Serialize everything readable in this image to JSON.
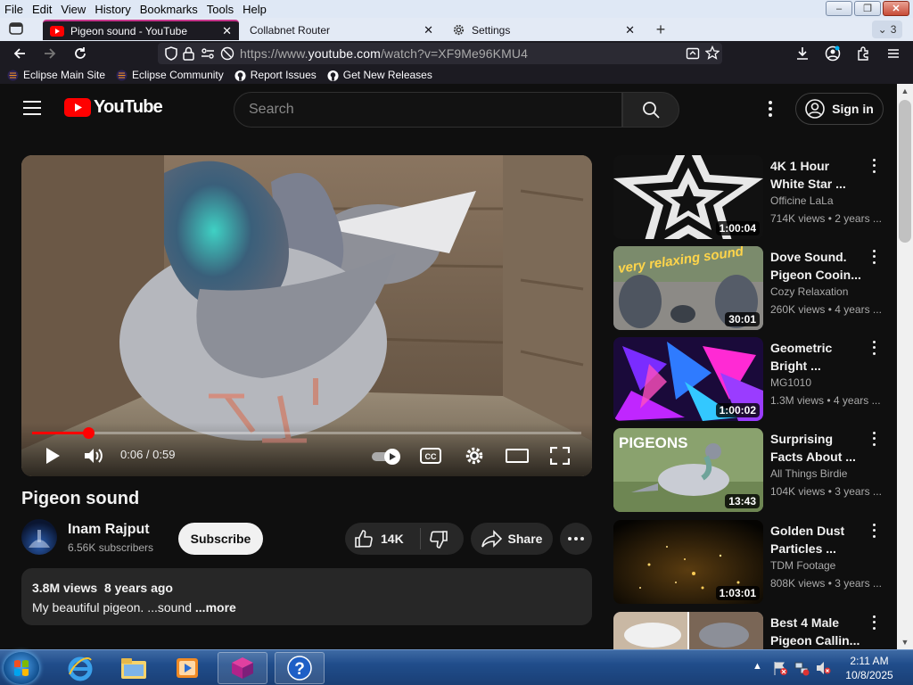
{
  "menubar": {
    "items": [
      "File",
      "Edit",
      "View",
      "History",
      "Bookmarks",
      "Tools",
      "Help"
    ]
  },
  "window_controls": {
    "minimize": "–",
    "maximize": "❐",
    "close": "✕"
  },
  "tabs": [
    {
      "label": "Pigeon sound - YouTube",
      "active": true
    },
    {
      "label": "Collabnet Router",
      "active": false
    },
    {
      "label": "Settings",
      "active": false
    }
  ],
  "tabbar": {
    "new_tab": "+",
    "tab_count": "3"
  },
  "navbar": {
    "url_prefix": "https://www.",
    "url_main": "youtube.com",
    "url_rest": "/watch?v=XF9Me96KMU4"
  },
  "bookmarks": [
    "Eclipse Main Site",
    "Eclipse Community",
    "Report Issues",
    "Get New Releases"
  ],
  "youtube": {
    "logo_text": "YouTube",
    "search_placeholder": "Search",
    "sign_in": "Sign in",
    "player": {
      "time": "0:06 / 0:59",
      "progress_fraction": 0.102
    },
    "video_title": "Pigeon sound",
    "channel": {
      "name": "Inam Rajput",
      "subscribers": "6.56K subscribers"
    },
    "subscribe": "Subscribe",
    "likes": "14K",
    "share": "Share",
    "description": {
      "views": "3.8M views",
      "age": "8 years ago",
      "text": "My beautiful  pigeon. ...sound",
      "more": "...more"
    },
    "recommendations": [
      {
        "title1": "4K 1 Hour",
        "title2": "White Star ...",
        "channel": "Officine LaLa",
        "meta": "714K views • 2 years ...",
        "duration": "1:00:04"
      },
      {
        "title1": "Dove Sound.",
        "title2": "Pigeon Cooin...",
        "channel": "Cozy Relaxation",
        "meta": "260K views • 4 years ...",
        "duration": "30:01",
        "overlay": "very relaxing sound"
      },
      {
        "title1": "Geometric",
        "title2": "Bright ...",
        "channel": "MG1010",
        "meta": "1.3M views • 4 years ...",
        "duration": "1:00:02"
      },
      {
        "title1": "Surprising",
        "title2": "Facts About ...",
        "channel": "All Things Birdie",
        "meta": "104K views • 3 years ...",
        "duration": "13:43",
        "overlay": "PIGEONS"
      },
      {
        "title1": "Golden Dust",
        "title2": "Particles ...",
        "channel": "TDM Footage",
        "meta": "808K views • 3 years ...",
        "duration": "1:03:01"
      },
      {
        "title1": "Best 4 Male",
        "title2": "Pigeon Callin...",
        "channel": "",
        "meta": "",
        "duration": ""
      }
    ]
  },
  "taskbar": {
    "time": "2:11 AM",
    "date": "10/8/2025"
  },
  "colors": {
    "youtube_red": "#ff0000",
    "bg": "#0f0f0f",
    "firefox_accent": "#c6358a"
  }
}
